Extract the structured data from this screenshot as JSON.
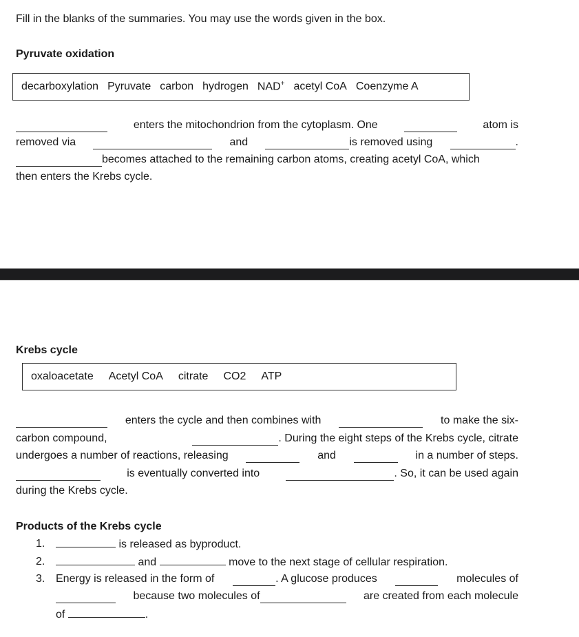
{
  "instructions": "Fill in the blanks of the summaries. You may use the words given in the box.",
  "pyruvate": {
    "heading": "Pyruvate oxidation",
    "word_bank": [
      "decarboxylation",
      "Pyruvate",
      "carbon",
      "hydrogen",
      "NAD",
      "acetyl CoA",
      "Coenzyme A"
    ],
    "nad_superscript": "+",
    "line1": {
      "t1": "enters the mitochondrion from the cytoplasm. One",
      "t2": "atom is"
    },
    "line2": {
      "t1": "removed via",
      "t2": "and",
      "t3": "is removed using",
      "t4": "."
    },
    "line3": {
      "t1": "becomes attached to the remaining carbon atoms, creating acetyl CoA, which"
    },
    "line4": "then enters the Krebs cycle."
  },
  "krebs": {
    "heading": "Krebs cycle",
    "word_bank": [
      "oxaloacetate",
      "Acetyl CoA",
      "citrate",
      "CO2",
      "ATP"
    ],
    "line1": {
      "t1": "enters the cycle and then combines with",
      "t2": "to make the six-"
    },
    "line2": {
      "t1": "carbon compound,",
      "t2": ". During the eight steps of the Krebs cycle, citrate"
    },
    "line3": {
      "t1": "undergoes a number of reactions, releasing",
      "t2": "and",
      "t3": "in a number of steps."
    },
    "line4": {
      "t1": "is eventually converted into",
      "t2": ". So, it can be used again"
    },
    "line5": "during the Krebs cycle."
  },
  "products": {
    "heading": "Products of the Krebs cycle",
    "items": [
      {
        "num": "1.",
        "t1": "is released as byproduct."
      },
      {
        "num": "2.",
        "t1": "and",
        "t2": "move to the next stage of cellular respiration."
      },
      {
        "num": "3.",
        "t1": "Energy is released in the form of",
        "t2": ". A glucose produces",
        "t3": "molecules of",
        "t4": "because two molecules of",
        "t5": "are created from each molecule",
        "t6": "of",
        "t7": "."
      }
    ]
  }
}
